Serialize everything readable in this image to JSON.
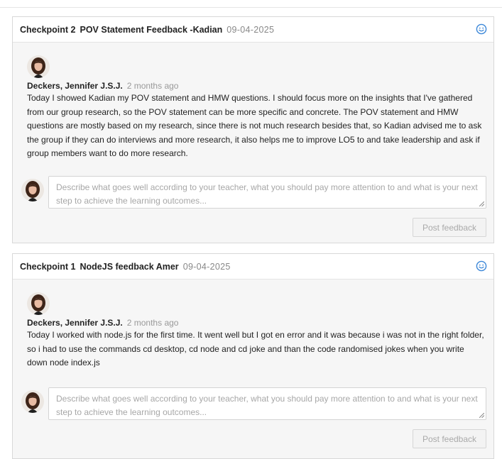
{
  "checkpoints": [
    {
      "title": "Checkpoint 2",
      "name": "POV Statement Feedback -Kadian",
      "date": "09-04-2025",
      "comment": {
        "author": "Deckers, Jennifer J.S.J.",
        "time_ago": "2 months ago",
        "text": "Today I showed Kadian my POV statement and HMW questions. I should focus more on the insights that I've gathered from our group research, so the POV statement can be more specific and concrete. The POV statement and HMW questions are mostly based on my research, since there is not much research besides that, so Kadian advised me to ask the group if they can do interviews and more research, it also helps me to improve LO5 to and take leadership and ask if group members want to do more research."
      },
      "reply_placeholder": "Describe what goes well according to your teacher, what you should pay more attention to and what is your next step to achieve the learning outcomes...",
      "post_label": "Post feedback"
    },
    {
      "title": "Checkpoint 1",
      "name": "NodeJS feedback Amer",
      "date": "09-04-2025",
      "comment": {
        "author": "Deckers, Jennifer J.S.J.",
        "time_ago": "2 months ago",
        "text": "Today I worked with node.js for the first time. It went well but I got en error and it was because i was not in the right folder, so i had to use the commands cd desktop, cd node and cd joke and than the code randomised jokes when you write down node index.js"
      },
      "reply_placeholder": "Describe what goes well according to your teacher, what you should pay more attention to and what is your next step to achieve the learning outcomes...",
      "post_label": "Post feedback"
    }
  ],
  "icons": {
    "header_status": "smiley-icon",
    "avatar": "user-avatar"
  },
  "colors": {
    "accent": "#3a86d8",
    "card_bg": "#f6f6f6",
    "border": "#d8d8d8"
  }
}
